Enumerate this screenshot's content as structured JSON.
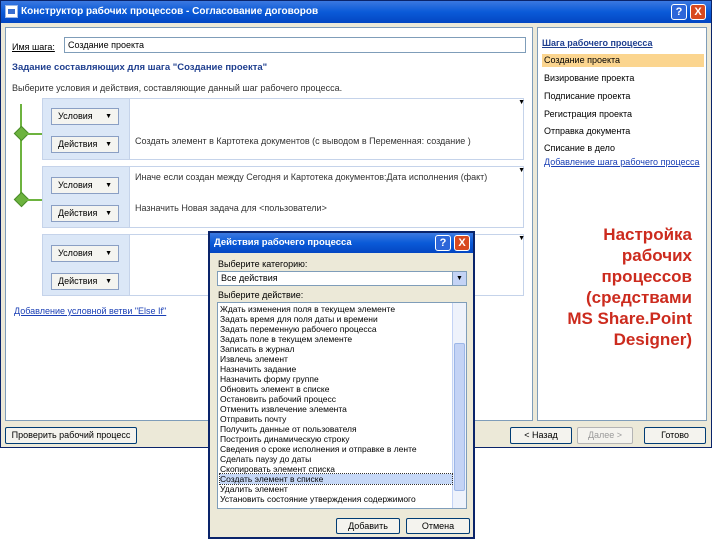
{
  "window": {
    "title": "Конструктор рабочих процессов - Согласование договоров",
    "help": "?",
    "close": "X"
  },
  "step": {
    "name_label": "Имя шага:",
    "name_value": "Создание проекта",
    "section_title": "Задание составляющих для шага \"Создание проекта\"",
    "section_sub": "Выберите условия и действия, составляющие данный шаг рабочего процесса."
  },
  "branches": [
    {
      "condition_btn": "Условия",
      "action_btn": "Действия",
      "action_text": "Создать элемент в Картотека документов (с выводом в Переменная: создание )"
    },
    {
      "condition_btn": "Условия",
      "condition_text": "Иначе если создан между Сегодня и Картотека документов:Дата исполнения (факт)",
      "action_btn": "Действия",
      "action_text": "Назначить Новая задача для <пользователи>"
    },
    {
      "condition_btn": "Условия",
      "action_btn": "Действия"
    }
  ],
  "else_if_link": "Добавление условной ветви \"Else If\"",
  "bottom_buttons": {
    "check": "Проверить рабочий процесс",
    "back": "< Назад",
    "next": "Далее >",
    "finish": "Готово"
  },
  "side_panel": {
    "title": "Шага рабочего процесса",
    "items": [
      "Создание проекта",
      "Визирование проекта",
      "Подписание проекта",
      "Регистрация проекта",
      "Отправка документа",
      "Списание в дело"
    ],
    "add_link": "Добавление шага рабочего процесса"
  },
  "dialog": {
    "title": "Действия рабочего процесса",
    "help": "?",
    "close": "X",
    "category_label": "Выберите категорию:",
    "category_value": "Все действия",
    "action_label": "Выберите действие:",
    "actions": [
      "Ждать изменения поля в текущем элементе",
      "Задать время для поля даты и времени",
      "Задать переменную рабочего процесса",
      "Задать поле в текущем элементе",
      "Записать в журнал",
      "Извлечь элемент",
      "Назначить задание",
      "Назначить форму группе",
      "Обновить элемент в списке",
      "Остановить рабочий процесс",
      "Отменить извлечение элемента",
      "Отправить почту",
      "Получить данные от пользователя",
      "Построить динамическую строку",
      "Сведения о сроке исполнения и отправке в ленте",
      "Сделать паузу до даты",
      "Скопировать элемент списка",
      "Создать элемент в списке",
      "Удалить элемент",
      "Установить состояние утверждения содержимого"
    ],
    "selected_index": 17,
    "add_button": "Добавить",
    "cancel_button": "Отмена"
  },
  "caption": {
    "lines": [
      "Настройка",
      "рабочих",
      "процессов",
      "(средствами",
      "MS Share.Point",
      "Designer)"
    ]
  },
  "colors": {
    "title_blue": "#0a5ad8",
    "accent_green": "#6db33f",
    "caption_red": "#cc2b1e",
    "active_item": "#fbd58f"
  }
}
